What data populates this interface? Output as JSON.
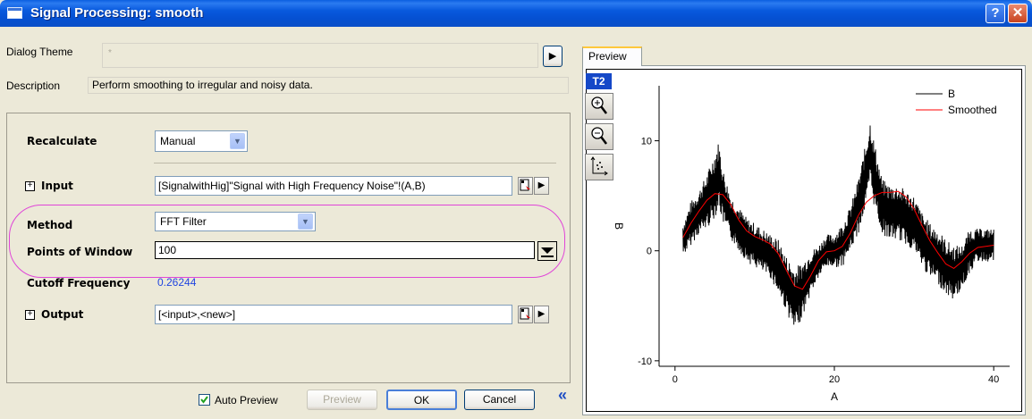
{
  "window": {
    "title": "Signal Processing: smooth"
  },
  "dialog_theme": {
    "label": "Dialog Theme",
    "value": "*",
    "arrow": "▶"
  },
  "description": {
    "label": "Description",
    "text": "Perform smoothing to irregular and noisy data."
  },
  "params": {
    "recalculate": {
      "label": "Recalculate",
      "value": "Manual"
    },
    "input": {
      "label": "Input",
      "value": "[SignalwithHig]\"Signal with High Frequency Noise\"!(A,B)"
    },
    "method": {
      "label": "Method",
      "value": "FFT Filter"
    },
    "points_of_window": {
      "label": "Points of Window",
      "value": "100"
    },
    "cutoff_frequency": {
      "label": "Cutoff Frequency",
      "value": "0.26244"
    },
    "output": {
      "label": "Output",
      "value": "[<input>,<new>]"
    }
  },
  "buttons": {
    "auto_preview": "Auto Preview",
    "auto_preview_checked": true,
    "preview": "Preview",
    "ok": "OK",
    "cancel": "Cancel",
    "collapse": "«"
  },
  "preview": {
    "tab_label": "Preview",
    "layer_badge": "T2",
    "toolbar_icons": [
      "zoom-in-icon",
      "zoom-out-icon",
      "rescale-icon"
    ]
  },
  "chart_data": {
    "type": "line",
    "xlabel": "A",
    "ylabel": "B",
    "xlim": [
      -2,
      42
    ],
    "ylim": [
      -10.5,
      15
    ],
    "x_ticks": [
      0,
      20,
      40
    ],
    "y_ticks": [
      -10,
      0,
      10
    ],
    "legend_position": "top-right",
    "series": [
      {
        "name": "B",
        "color": "#000000",
        "style": "noisy",
        "x": [
          1,
          2,
          3,
          4,
          5,
          5.5,
          6,
          7,
          8,
          9,
          10,
          11,
          12,
          13,
          14,
          15,
          16,
          17,
          18,
          19,
          20,
          21,
          22,
          23,
          24,
          24.5,
          25,
          26,
          27,
          28,
          29,
          30,
          31,
          32,
          33,
          34,
          35,
          36,
          37,
          38,
          39,
          40
        ],
        "y": [
          1,
          2.5,
          3.5,
          4.5,
          6,
          7,
          5,
          3,
          2,
          1,
          0.5,
          0,
          -0.5,
          -1.5,
          -3,
          -4.5,
          -3.5,
          -2,
          -1,
          0,
          0,
          0.5,
          2,
          4,
          7,
          9,
          7,
          4,
          3.5,
          3.5,
          3,
          2.5,
          1,
          0,
          -0.5,
          -1.5,
          -2,
          -1.5,
          0,
          0.5,
          0.5,
          0.5
        ],
        "amplitude": [
          1.5,
          2,
          2,
          2.5,
          3,
          3,
          2.5,
          2,
          2,
          2,
          2,
          2,
          2,
          2.5,
          2.5,
          3,
          2.5,
          2,
          1.5,
          1.5,
          1.5,
          2,
          2,
          2.5,
          3,
          3,
          3,
          2.5,
          2.5,
          2.5,
          2.5,
          2.5,
          2.5,
          2.5,
          2.5,
          2.5,
          2.5,
          2,
          2,
          1.5,
          1.5,
          1.5
        ]
      },
      {
        "name": "Smoothed",
        "color": "#FF0000",
        "x": [
          1,
          2,
          3,
          4,
          5,
          6,
          7,
          8,
          9,
          10,
          11,
          12,
          13,
          14,
          15,
          16,
          17,
          18,
          19,
          20,
          21,
          22,
          23,
          24,
          25,
          26,
          27,
          28,
          29,
          30,
          31,
          32,
          33,
          34,
          35,
          36,
          37,
          38,
          39,
          40
        ],
        "y": [
          1.2,
          2.5,
          3.6,
          4.6,
          5.2,
          5.1,
          4.2,
          2.8,
          1.8,
          1.3,
          1.0,
          0.6,
          -0.3,
          -1.8,
          -3.2,
          -3.5,
          -2.3,
          -0.9,
          -0.1,
          0.0,
          0.4,
          1.6,
          3.2,
          4.4,
          5.0,
          5.3,
          5.3,
          5.4,
          4.9,
          3.8,
          2.3,
          0.9,
          -0.2,
          -1.2,
          -1.6,
          -1.0,
          -0.2,
          0.3,
          0.4,
          0.5
        ]
      }
    ]
  }
}
